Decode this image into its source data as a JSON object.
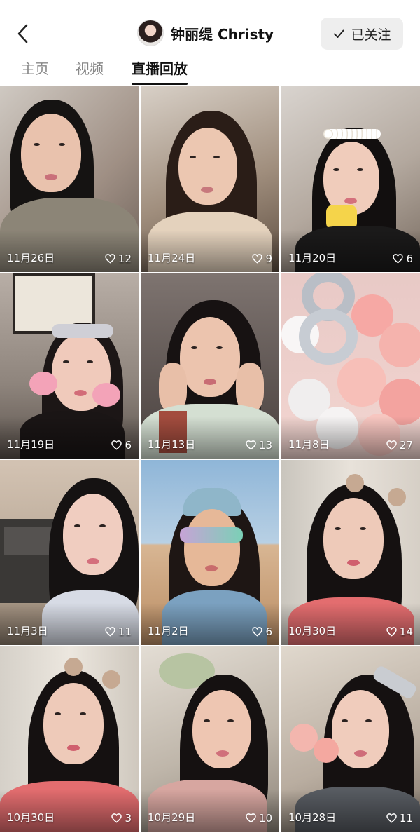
{
  "header": {
    "username": "钟丽缇 Christy",
    "follow_label": "已关注"
  },
  "tabs": [
    {
      "label": "主页",
      "active": false
    },
    {
      "label": "视频",
      "active": false
    },
    {
      "label": "直播回放",
      "active": true
    }
  ],
  "videos": [
    {
      "date": "11月26日",
      "likes": "12"
    },
    {
      "date": "11月24日",
      "likes": "9"
    },
    {
      "date": "11月20日",
      "likes": "6"
    },
    {
      "date": "11月19日",
      "likes": "6"
    },
    {
      "date": "11月13日",
      "likes": "13"
    },
    {
      "date": "11月8日",
      "likes": "27"
    },
    {
      "date": "11月3日",
      "likes": "11"
    },
    {
      "date": "11月2日",
      "likes": "6"
    },
    {
      "date": "10月30日",
      "likes": "14"
    },
    {
      "date": "10月30日",
      "likes": "3"
    },
    {
      "date": "10月29日",
      "likes": "10"
    },
    {
      "date": "10月28日",
      "likes": "11"
    }
  ],
  "icons": {
    "back": "chevron-left-icon",
    "follow": "check-icon",
    "likes": "heart-outline-icon"
  }
}
